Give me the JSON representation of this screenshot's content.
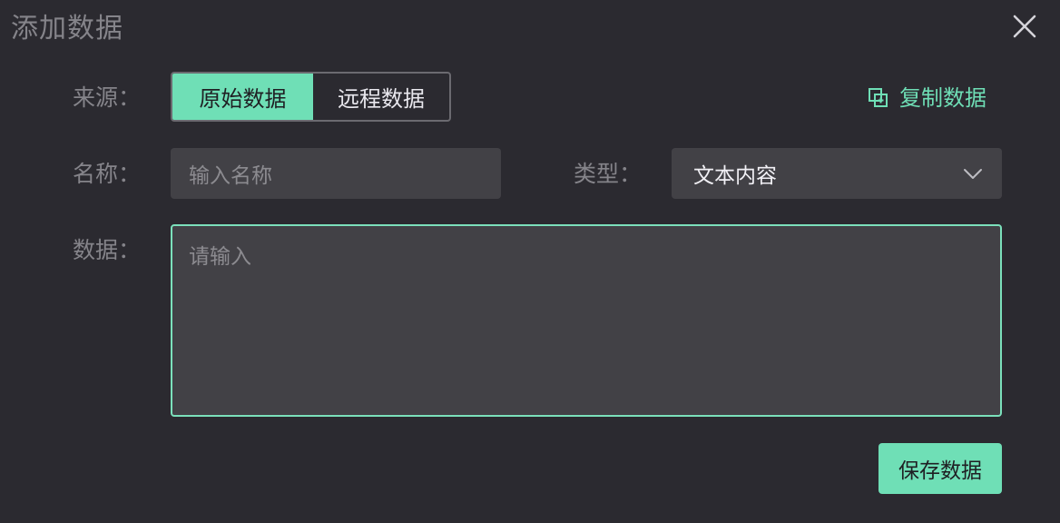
{
  "dialog": {
    "title": "添加数据",
    "close_icon": "close-icon"
  },
  "source": {
    "label": "来源：",
    "options": [
      "原始数据",
      "远程数据"
    ],
    "selected": "原始数据"
  },
  "copy": {
    "label": "复制数据",
    "icon": "copy-icon"
  },
  "name": {
    "label": "名称：",
    "placeholder": "输入名称",
    "value": ""
  },
  "type": {
    "label": "类型：",
    "value": "文本内容",
    "icon": "chevron-down-icon"
  },
  "data": {
    "label": "数据：",
    "placeholder": "请输入",
    "value": ""
  },
  "actions": {
    "save_label": "保存数据"
  },
  "colors": {
    "accent": "#6fdfb6",
    "background": "#2b2a30",
    "field": "#424146",
    "muted_text": "#85848a"
  }
}
